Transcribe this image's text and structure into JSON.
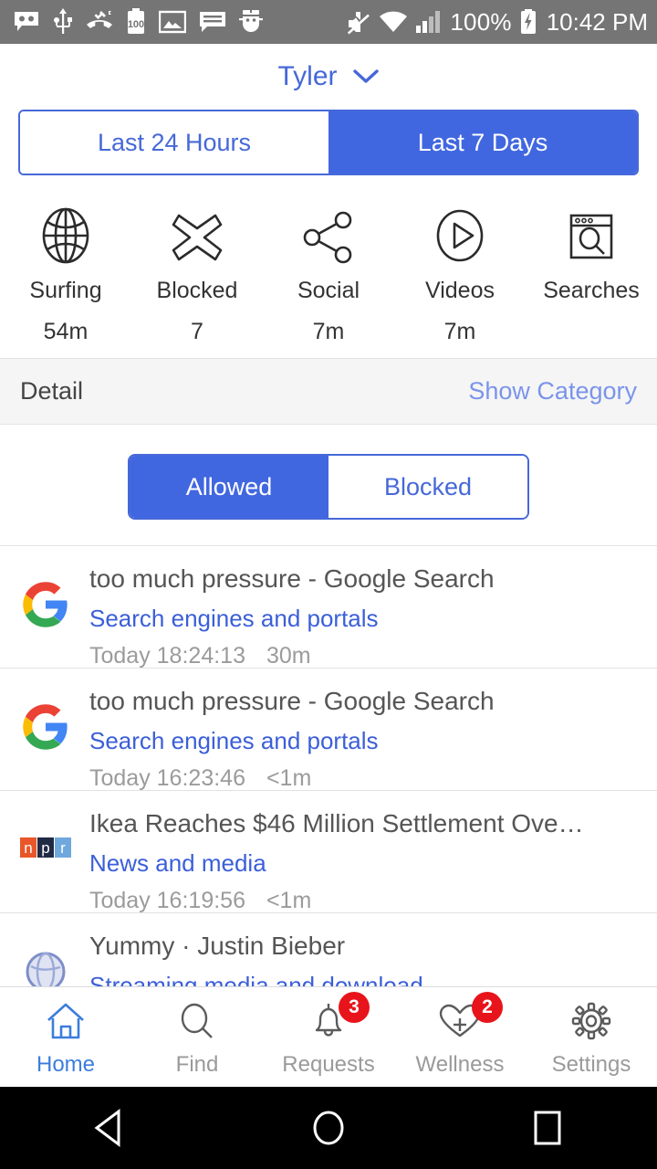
{
  "status_bar": {
    "left_icons": [
      "voicemail-icon",
      "usb-icon",
      "missed-call-icon",
      "battery-100-icon",
      "screenshot-icon",
      "sms-icon",
      "debug-bug-icon"
    ],
    "right_icons": [
      "mute-icon",
      "wifi-icon",
      "cellular-signal-icon"
    ],
    "battery_percent": "100%",
    "battery_state_icon": "battery-charging-icon",
    "time": "10:42 PM"
  },
  "header": {
    "profile_name": "Tyler",
    "dropdown_icon": "chevron-down-icon"
  },
  "period_tabs": {
    "options": [
      "Last 24 Hours",
      "Last 7 Days"
    ],
    "selected": "Last 7 Days"
  },
  "stats": [
    {
      "icon": "globe-icon",
      "label": "Surfing",
      "value": "54m"
    },
    {
      "icon": "x-block-icon",
      "label": "Blocked",
      "value": "7"
    },
    {
      "icon": "share-icon",
      "label": "Social",
      "value": "7m"
    },
    {
      "icon": "play-icon",
      "label": "Videos",
      "value": "7m"
    },
    {
      "icon": "browser-search-icon",
      "label": "Searches",
      "value": ""
    }
  ],
  "detail_bar": {
    "title": "Detail",
    "action_label": "Show Category"
  },
  "filter_tabs": {
    "options": [
      "Allowed",
      "Blocked"
    ],
    "selected": "Allowed"
  },
  "activity": [
    {
      "icon": "google-logo-icon",
      "title": "too much pressure - Google Search",
      "category": "Search engines and portals",
      "time": "Today 18:24:13",
      "duration": "30m"
    },
    {
      "icon": "google-logo-icon",
      "title": "too much pressure - Google Search",
      "category": "Search engines and portals",
      "time": "Today 16:23:46",
      "duration": "<1m"
    },
    {
      "icon": "npr-logo-icon",
      "title": "Ikea Reaches $46 Million Settlement Ove…",
      "category": "News and media",
      "time": "Today 16:19:56",
      "duration": "<1m"
    },
    {
      "icon": "globe-favicon-icon",
      "title": "Yummy · Justin Bieber",
      "category": "Streaming media and download",
      "time": "",
      "duration": ""
    }
  ],
  "bottom_nav": [
    {
      "icon": "home-icon",
      "label": "Home",
      "badge": "",
      "active": true
    },
    {
      "icon": "search-icon",
      "label": "Find",
      "badge": "",
      "active": false
    },
    {
      "icon": "bell-icon",
      "label": "Requests",
      "badge": "3",
      "active": false
    },
    {
      "icon": "heart-plus-icon",
      "label": "Wellness",
      "badge": "2",
      "active": false
    },
    {
      "icon": "gear-icon",
      "label": "Settings",
      "badge": "",
      "active": false
    }
  ],
  "system_nav": {
    "back_icon": "triangle-back-icon",
    "home_icon": "circle-home-icon",
    "recents_icon": "square-recents-icon"
  },
  "colors": {
    "accent_blue": "#4167e0",
    "link_blue": "#3b5fd8",
    "badge_red": "#e8141b",
    "statusbar_gray": "#757575"
  }
}
